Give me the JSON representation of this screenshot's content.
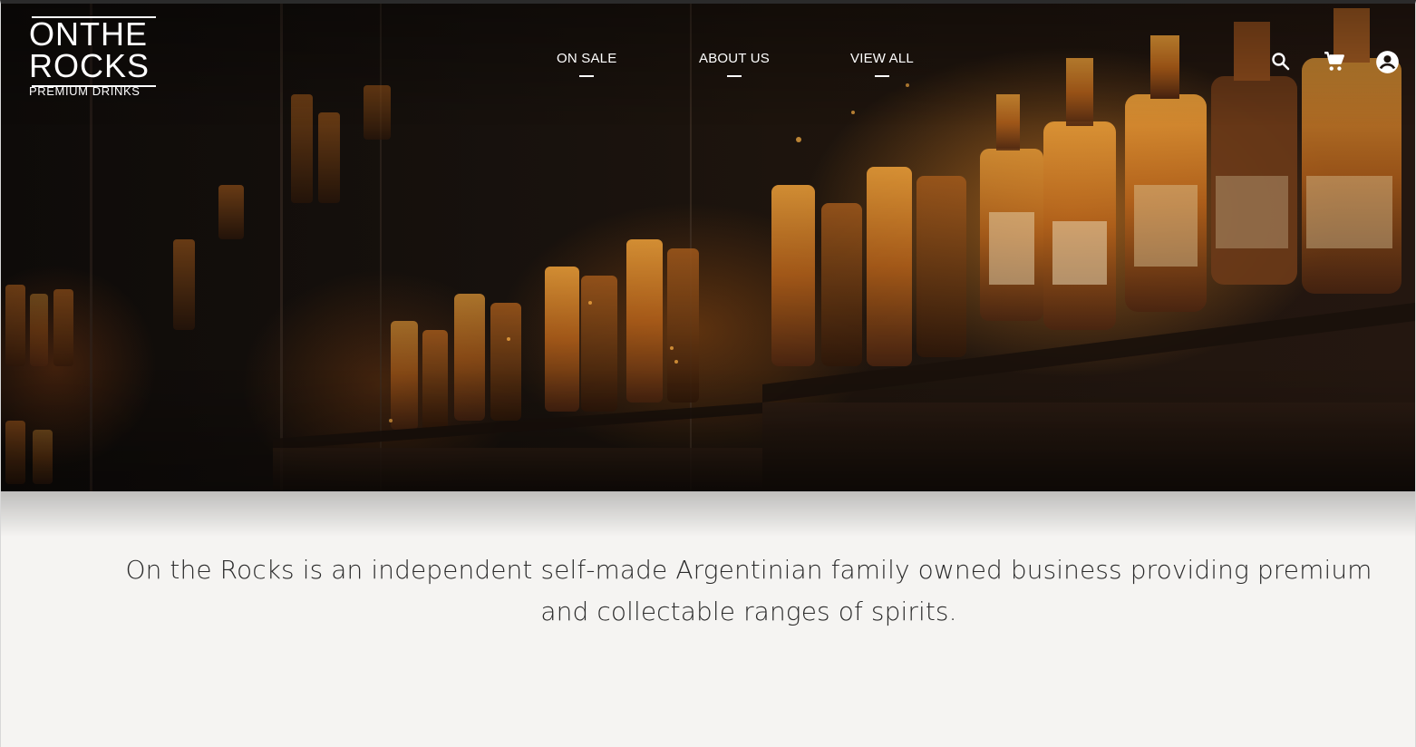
{
  "brand": {
    "logo_line1": "ONTHE",
    "logo_line2": "ROCKS",
    "logo_tagline": "PREMIUM DRINKS"
  },
  "nav": {
    "items": [
      {
        "label": "ON SALE"
      },
      {
        "label": "ABOUT US"
      },
      {
        "label": "VIEW ALL"
      }
    ]
  },
  "header_icons": [
    "search-icon",
    "cart-icon",
    "account-icon"
  ],
  "hero": {
    "image": "bar-shelves-with-whisky-bottles"
  },
  "intro": {
    "text": "On the Rocks is an independent self-made Argentinian family owned business providing premium and collectable ranges of spirits."
  },
  "colors": {
    "text_dark": "#2b2b2b",
    "page_background": "#f5f4f2",
    "hero_glow": "#e0901f"
  }
}
